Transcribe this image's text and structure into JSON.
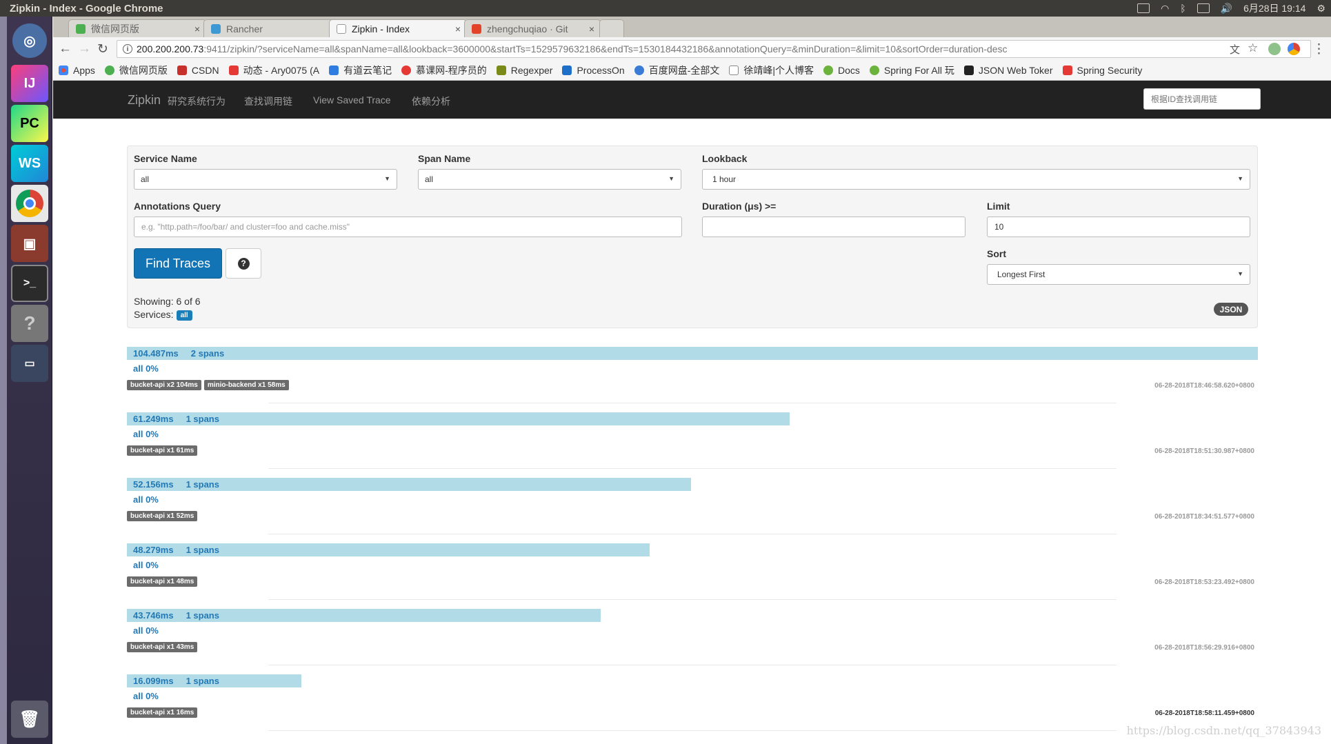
{
  "window": {
    "title": "Zipkin - Index - Google Chrome"
  },
  "system_panel": {
    "datetime": "6月28日 19:14"
  },
  "tabs": [
    {
      "label": "微信网页版",
      "color": "#4caf50",
      "active": false
    },
    {
      "label": "Rancher",
      "color": "#3d98d3",
      "active": false
    },
    {
      "label": "Zipkin - Index",
      "color": "#999999",
      "active": true
    },
    {
      "label": "zhengchuqiao · Git",
      "color": "#e24329",
      "active": false
    }
  ],
  "address": {
    "host": "200.200.200.73",
    "rest": ":9411/zipkin/?serviceName=all&spanName=all&lookback=3600000&startTs=1529579632186&endTs=1530184432186&annotationQuery=&minDuration=&limit=10&sortOrder=duration-desc"
  },
  "bookmarks": [
    {
      "label": "Apps",
      "color": "#e04f3b"
    },
    {
      "label": "微信网页版",
      "color": "#4caf50"
    },
    {
      "label": "CSDN",
      "color": "#c7302b"
    },
    {
      "label": "动态 - Ary0075 (A",
      "color": "#e53935"
    },
    {
      "label": "有道云笔记",
      "color": "#2f7de1"
    },
    {
      "label": "慕课网-程序员的",
      "color": "#e53935"
    },
    {
      "label": "Regexper",
      "color": "#7a8b1a"
    },
    {
      "label": "ProcessOn",
      "color": "#1e6fc7"
    },
    {
      "label": "百度网盘-全部文",
      "color": "#3a7bd5"
    },
    {
      "label": "徐靖峰|个人博客",
      "color": "#888888"
    },
    {
      "label": "Docs",
      "color": "#6bb33d"
    },
    {
      "label": "Spring For All 玩",
      "color": "#6bb33d"
    },
    {
      "label": "JSON Web Toker",
      "color": "#222222"
    },
    {
      "label": "Spring Security",
      "color": "#e53935"
    }
  ],
  "navbar": {
    "brand": "Zipkin",
    "links": [
      "研究系统行为",
      "查找调用链",
      "View Saved Trace",
      "依赖分析"
    ],
    "trace_id_placeholder": "根据ID查找调用链"
  },
  "search": {
    "service_name_label": "Service Name",
    "service_name_value": "all",
    "span_name_label": "Span Name",
    "span_name_value": "all",
    "lookback_label": "Lookback",
    "lookback_value": "1 hour",
    "annotations_label": "Annotations Query",
    "annotations_placeholder": "e.g. \"http.path=/foo/bar/ and cluster=foo and cache.miss\"",
    "duration_label": "Duration (μs) >=",
    "duration_value": "",
    "limit_label": "Limit",
    "limit_value": "10",
    "sort_label": "Sort",
    "sort_value": "Longest First",
    "find_button": "Find Traces",
    "help_icon": "?",
    "showing": "Showing: 6 of 6",
    "services_label": "Services:",
    "services_badge": "all",
    "json_badge": "JSON"
  },
  "traces": [
    {
      "duration": "104.487ms",
      "spans": "2 spans",
      "width_fraction": 1.0,
      "service": "all 0%",
      "tags": [
        "bucket-api x2 104ms",
        "minio-backend x1 58ms"
      ],
      "timestamp": "06-28-2018T18:46:58.620+0800"
    },
    {
      "duration": "61.249ms",
      "spans": "1 spans",
      "width_fraction": 0.586,
      "service": "all 0%",
      "tags": [
        "bucket-api x1 61ms"
      ],
      "timestamp": "06-28-2018T18:51:30.987+0800"
    },
    {
      "duration": "52.156ms",
      "spans": "1 spans",
      "width_fraction": 0.499,
      "service": "all 0%",
      "tags": [
        "bucket-api x1 52ms"
      ],
      "timestamp": "06-28-2018T18:34:51.577+0800"
    },
    {
      "duration": "48.279ms",
      "spans": "1 spans",
      "width_fraction": 0.462,
      "service": "all 0%",
      "tags": [
        "bucket-api x1 48ms"
      ],
      "timestamp": "06-28-2018T18:53:23.492+0800"
    },
    {
      "duration": "43.746ms",
      "spans": "1 spans",
      "width_fraction": 0.419,
      "service": "all 0%",
      "tags": [
        "bucket-api x1 43ms"
      ],
      "timestamp": "06-28-2018T18:56:29.916+0800"
    },
    {
      "duration": "16.099ms",
      "spans": "1 spans",
      "width_fraction": 0.154,
      "service": "all 0%",
      "tags": [
        "bucket-api x1 16ms"
      ],
      "timestamp": "06-28-2018T18:58:11.459+0800"
    }
  ],
  "watermark": "https://blog.csdn.net/qq_37843943"
}
